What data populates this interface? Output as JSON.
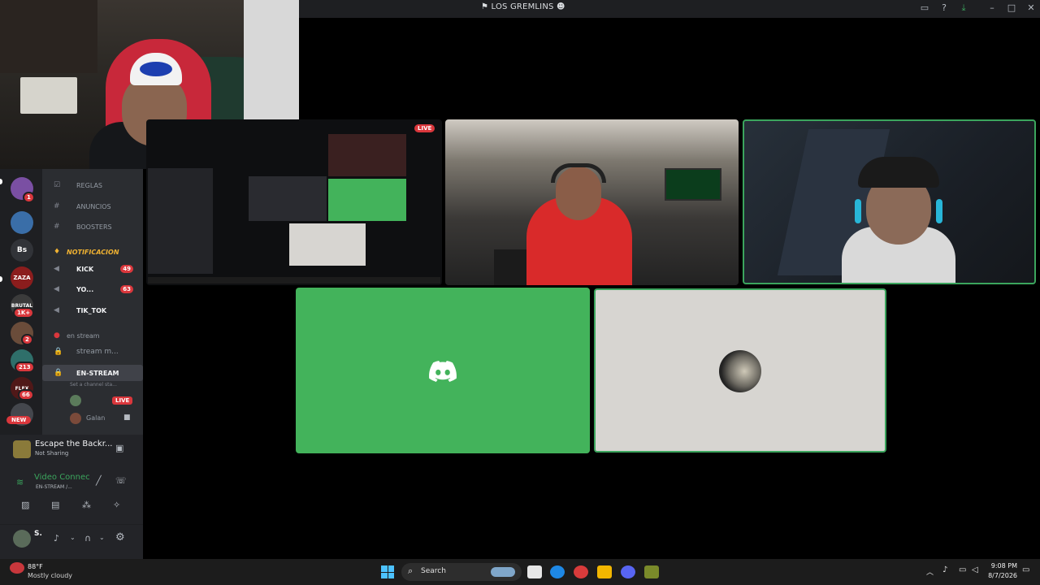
{
  "window": {
    "title": "LOS GREMLINS"
  },
  "servers": [
    {
      "label": "Bs"
    },
    {
      "label": "ZAZA"
    },
    {
      "label": "BRUTAL",
      "badge": "1K+"
    },
    {
      "label": "",
      "badge": "2"
    },
    {
      "label": "",
      "badge": "213"
    },
    {
      "label": "FLEX",
      "badge": "66"
    },
    {
      "label": "NEW"
    }
  ],
  "channels": {
    "reglas": "REGLAS",
    "anuncios": "ANUNCIOS",
    "boosters": "BOOSTERS",
    "category_notificacion": "NOTIFICACION",
    "kick": "KICK",
    "kick_badge": "49",
    "yo": "YO...",
    "yo_badge": "63",
    "tiktok": "TIK_TOK",
    "category_en_stream": "en stream",
    "stream_m": "stream m...",
    "en_stream": "EN-STREAM",
    "channel_status": "Set a channel sta...",
    "live": "LIVE",
    "galan": "Galan"
  },
  "activity": {
    "game_name": "Escape the Backr...",
    "game_status": "Not Sharing",
    "voice_title": "Video Connec",
    "voice_channel": "EN-STREAM /..."
  },
  "user": {
    "initial": "S."
  },
  "tiles": {
    "screen_live": "LIVE"
  },
  "taskbar": {
    "weather_temp": "88°F",
    "weather_desc": "Mostly cloudy",
    "search_label": "Search",
    "time": "9:08 PM",
    "date": "8/7/2026"
  }
}
